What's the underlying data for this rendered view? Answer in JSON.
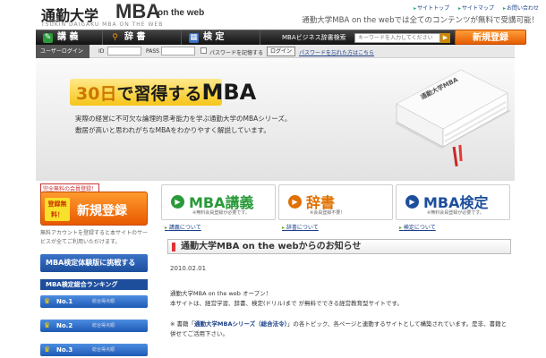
{
  "header": {
    "logo_main": "通勤大学",
    "logo_mba": "MBA",
    "logo_web": "on the web",
    "logo_sub": "TSUKIN DAIGAKU MBA ON THE WEB",
    "top_links": [
      "サイトトップ",
      "サイトマップ",
      "お問い合わせ"
    ],
    "catchphrase": "通勤大学MBA on the webでは全てのコンテンツが無料で受講可能！"
  },
  "nav": {
    "items": [
      {
        "label": "講 義",
        "icon": "pencil-icon"
      },
      {
        "label": "辞 書",
        "icon": "magnifier-icon"
      },
      {
        "label": "検 定",
        "icon": "grid-icon"
      }
    ],
    "dict_search_label": "MBAビジネス辞書検索",
    "search_placeholder": "キーワードを入力してください",
    "register_label": "新規登録"
  },
  "login": {
    "tag": "ユーザーログイン",
    "id_label": "ID",
    "pass_label": "PASS",
    "remember_label": "パスワードを記憶する",
    "login_button": "ログイン",
    "forgot_link": "パスワードを忘れた方はこちら"
  },
  "hero": {
    "title_prefix": "30日",
    "title_mid": "で習得する",
    "title_mba": "MBA",
    "text_line1": "実際の経営に不可欠な論理的思考能力を学ぶ通勤大学のMBAシリーズ。",
    "text_line2": "敷居が高いと思われがちなMBAをわかりやすく解説しています。",
    "book_text": "通勤大学MBA"
  },
  "left": {
    "free_badge": "完全無料の会員登録！",
    "reg_badge": "登録無料！",
    "reg_label": "新規登録",
    "note": "無料アカウントを登録すると本サイトのサービスが全てご利用いただけます。",
    "trial_label": "MBA検定体験版に挑戦する",
    "ranking_title": "MBA検定総合ランキング",
    "ranks": [
      {
        "label": "No.1",
        "sub": "総合得点順"
      },
      {
        "label": "No.2",
        "sub": "総合得点順"
      },
      {
        "label": "No.3",
        "sub": "総合得点順"
      }
    ]
  },
  "cards": [
    {
      "title": "MBA講義",
      "note": "※無料会員登録が必要です。",
      "link": "講義について",
      "color": "#2a9a3a"
    },
    {
      "title": "辞書",
      "note": "※会員登録不要！",
      "link": "辞書について",
      "color": "#e07000"
    },
    {
      "title": "MBA検定",
      "note": "※無料会員登録が必要です。",
      "link": "検定について",
      "color": "#1d4e9c"
    }
  ],
  "news": {
    "heading": "通勤大学MBA on the webからのお知らせ",
    "date": "2010.02.01",
    "body_line1": "通勤大学MBA on the web オープン！",
    "body_line2": "本サイトは、経営学習、辞書、検定(ドリル)まで が無料でできる経営教育型サイトです。",
    "foot_prefix": "※ 書籍「",
    "foot_book": "通勤大学MBAシリーズ（総合法令）",
    "foot_suffix": "」の各トピック、各ページと連動するサイトとして構築されています。是非、書籍と併せてご活用下さい。"
  }
}
